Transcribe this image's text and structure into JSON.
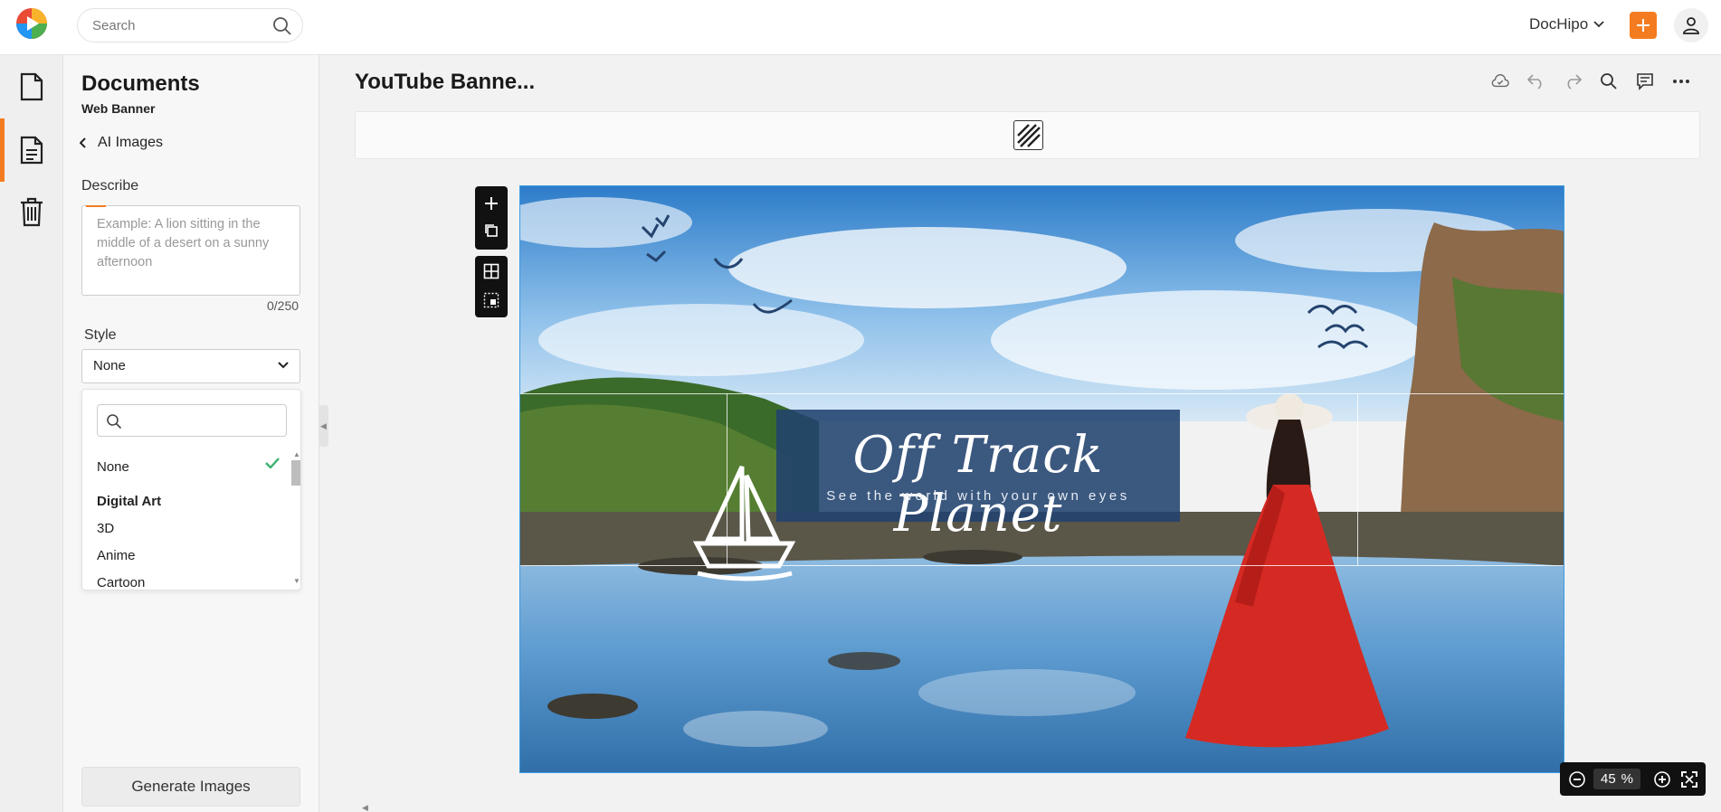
{
  "topbar": {
    "search_placeholder": "Search",
    "workspace": "DocHipo",
    "icons": [
      "app-logo",
      "search-icon",
      "chevron-down-icon",
      "plus-icon",
      "user-icon"
    ]
  },
  "rail": {
    "items": [
      {
        "name": "documents",
        "icon": "file-icon"
      },
      {
        "name": "active-document",
        "icon": "file-text-icon",
        "active": true
      },
      {
        "name": "trash",
        "icon": "trash-icon"
      }
    ]
  },
  "panel": {
    "title": "Documents",
    "subtitle": "Web Banner",
    "back_label": "AI Images",
    "describe_label": "Describe",
    "describe_placeholder": "Example: A lion sitting in the middle of a desert on a sunny afternoon",
    "describe_counter": "0/250",
    "style_label": "Style",
    "style_value": "None",
    "dropdown": {
      "items": [
        {
          "type": "option",
          "label": "None",
          "selected": true
        },
        {
          "type": "group",
          "label": "Digital Art"
        },
        {
          "type": "option",
          "label": "3D"
        },
        {
          "type": "option",
          "label": "Anime"
        },
        {
          "type": "option",
          "label": "Cartoon"
        }
      ]
    },
    "generate_label": "Generate Images"
  },
  "editor": {
    "doc_title": "YouTube Banne...",
    "tools": [
      "cloud-save-icon",
      "undo-icon",
      "redo-icon",
      "search-icon",
      "comment-icon",
      "more-icon"
    ]
  },
  "canvas": {
    "title": "Off Track Planet",
    "subtitle": "See the world with your own eyes",
    "accent": "#21426e"
  },
  "zoom": {
    "value": "45",
    "unit": "%"
  },
  "colors": {
    "brand_orange": "#f47c20",
    "selection_blue": "#3a9be0",
    "check_green": "#3cb371"
  }
}
